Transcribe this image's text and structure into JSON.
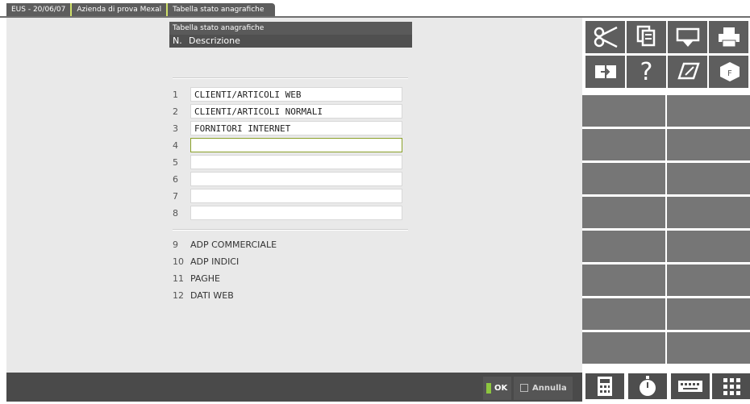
{
  "tabs": [
    "EUS - 20/06/07",
    "Azienda di prova Mexal",
    "Tabella stato anagrafiche"
  ],
  "panel": {
    "title": "Tabella stato anagrafiche",
    "header_num": "N.",
    "header_desc": "Descrizione"
  },
  "rows": [
    {
      "num": "1",
      "value": "CLIENTI/ARTICOLI WEB"
    },
    {
      "num": "2",
      "value": "CLIENTI/ARTICOLI NORMALI"
    },
    {
      "num": "3",
      "value": "FORNITORI INTERNET"
    },
    {
      "num": "4",
      "value": ""
    },
    {
      "num": "5",
      "value": ""
    },
    {
      "num": "6",
      "value": ""
    },
    {
      "num": "7",
      "value": ""
    },
    {
      "num": "8",
      "value": ""
    }
  ],
  "static_rows": [
    {
      "num": "9",
      "label": "ADP COMMERCIALE"
    },
    {
      "num": "10",
      "label": "ADP INDICI"
    },
    {
      "num": "11",
      "label": "PAGHE"
    },
    {
      "num": "12",
      "label": "DATI WEB"
    }
  ],
  "buttons": {
    "ok": "OK",
    "annulla": "Annulla"
  },
  "colors": {
    "accent": "#8dc63f",
    "focus_border": "#8aa12a",
    "bar": "#4a4a4a"
  }
}
